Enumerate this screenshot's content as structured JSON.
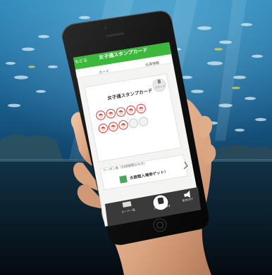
{
  "app": {
    "back_label": "もどる",
    "title": "女子通スタンプカード",
    "sub_left_label": "カード",
    "sub_right_label": "伝達情報"
  },
  "card": {
    "title": "女子通スタンプカード",
    "stamp_count_label": "8",
    "stamp_count_unit": "スタンプ",
    "stamped": 8,
    "total": 10
  },
  "coupon": {
    "label": "クーポン券（利用期限なもの）",
    "reward_label": "水族館入場券ゲット！"
  },
  "tabbar": {
    "left_label": "カード一覧",
    "center_label": "スタンプを押す",
    "right_label": "音声OFF"
  },
  "colors": {
    "header_green": "#3cb83c",
    "water_blue": "#1e6fa2",
    "skin": "#e2b392",
    "stamp_red": "#d64a4a"
  }
}
